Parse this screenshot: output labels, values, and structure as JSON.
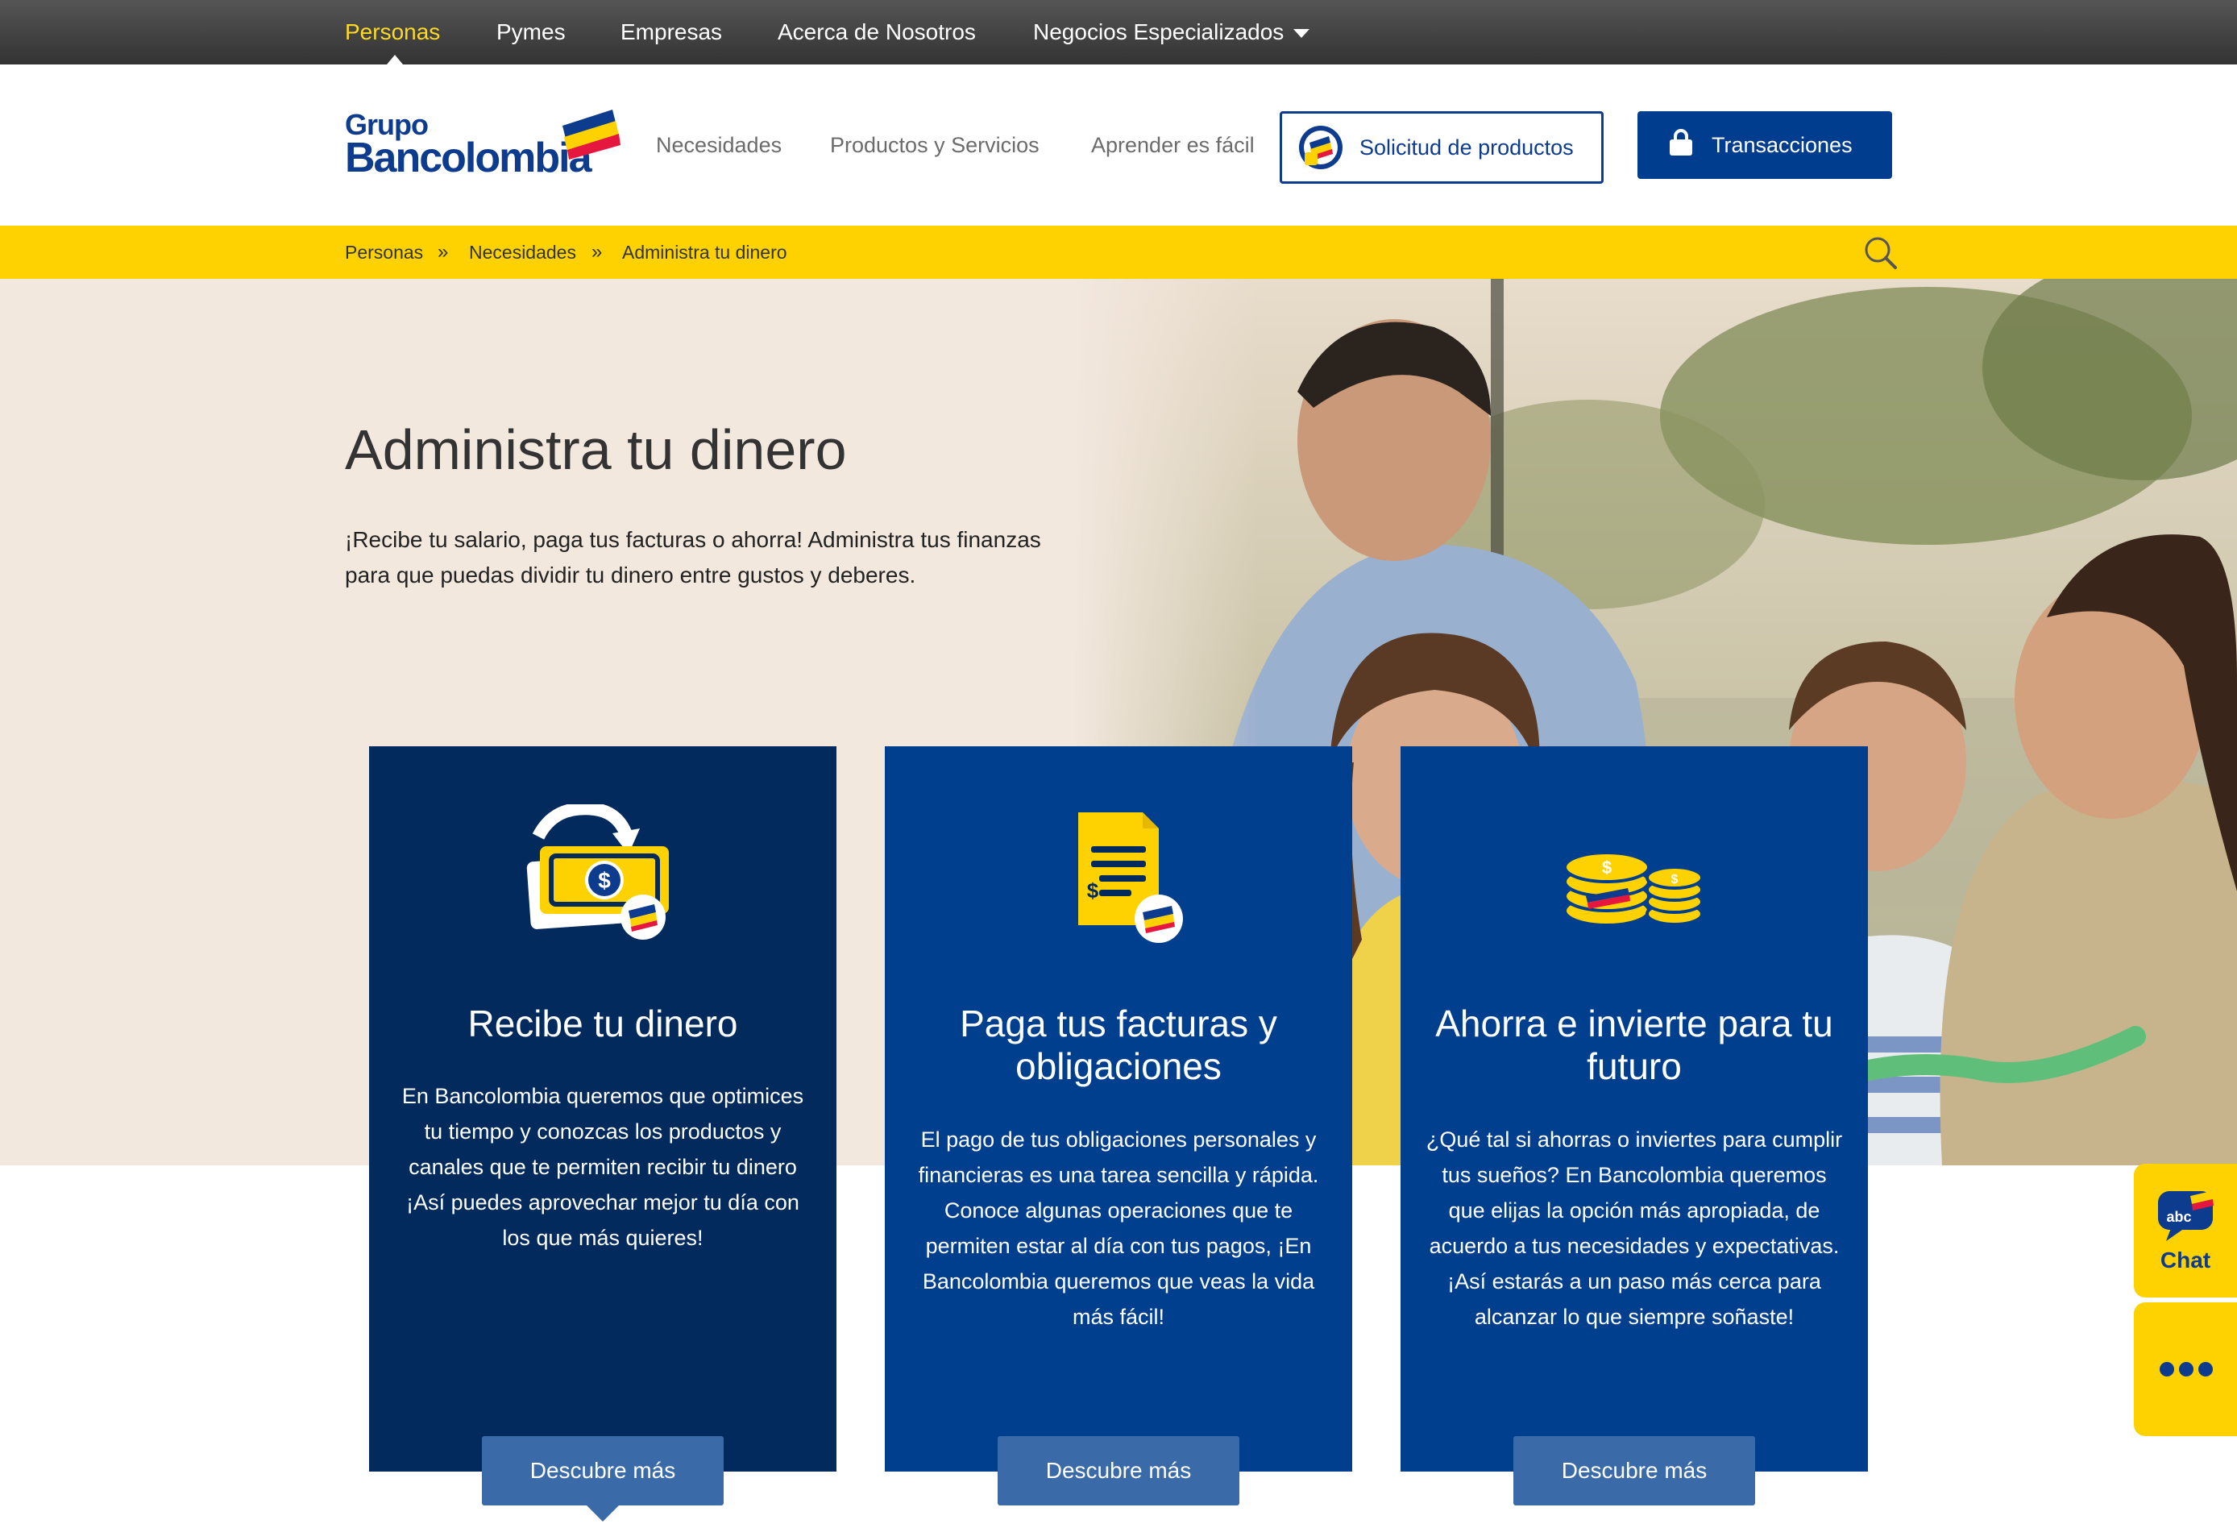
{
  "topnav": {
    "items": [
      {
        "label": "Personas"
      },
      {
        "label": "Pymes"
      },
      {
        "label": "Empresas"
      },
      {
        "label": "Acerca de Nosotros"
      },
      {
        "label": "Negocios Especializados"
      }
    ]
  },
  "header": {
    "logo_line1": "Grupo",
    "logo_line2": "Bancolombia",
    "nav": [
      {
        "label": "Necesidades"
      },
      {
        "label": "Productos y Servicios"
      },
      {
        "label": "Aprender es fácil"
      }
    ],
    "solicitud_label": "Solicitud de productos",
    "transacciones_label": "Transacciones"
  },
  "breadcrumb": {
    "items": [
      {
        "label": "Personas"
      },
      {
        "label": "Necesidades"
      },
      {
        "label": "Administra tu dinero"
      }
    ],
    "separator": "»"
  },
  "hero": {
    "title": "Administra tu dinero",
    "text": "¡Recibe tu salario, paga tus facturas o ahorra! Administra tus finanzas para que puedas dividir tu dinero entre gustos y deberes."
  },
  "cards": [
    {
      "title": "Recibe tu dinero",
      "body": "En Bancolombia queremos que optimices tu tiempo y conozcas los productos y canales que te permiten recibir tu dinero ¡Así puedes aprovechar mejor tu día con los que más quieres!",
      "button": "Descubre más",
      "icon": "money-transfer-icon",
      "color": "#022a5c"
    },
    {
      "title": "Paga tus facturas y obligaciones",
      "body": "El pago de tus obligaciones personales y financieras  es una tarea sencilla y rápida. Conoce algunas operaciones que te permiten estar al día con tus pagos, ¡En Bancolombia queremos que veas la vida más fácil!",
      "button": "Descubre más",
      "icon": "invoice-icon",
      "color": "#003f8e"
    },
    {
      "title": "Ahorra e invierte para tu futuro",
      "body": "¿Qué tal si ahorras o inviertes para cumplir tus sueños? En Bancolombia queremos que elijas la opción más apropiada, de acuerdo a tus necesidades y expectativas. ¡Así estarás a un paso más cerca para alcanzar lo que siempre soñaste!",
      "button": "Descubre más",
      "icon": "coins-icon",
      "color": "#003f8e"
    }
  ],
  "widgets": {
    "chat_label": "Chat",
    "chat_badge": "abc"
  },
  "colors": {
    "brand_yellow": "#fdd200",
    "brand_blue": "#0d3b8e",
    "card_dark": "#022a5c",
    "card_blue": "#003f8e"
  }
}
